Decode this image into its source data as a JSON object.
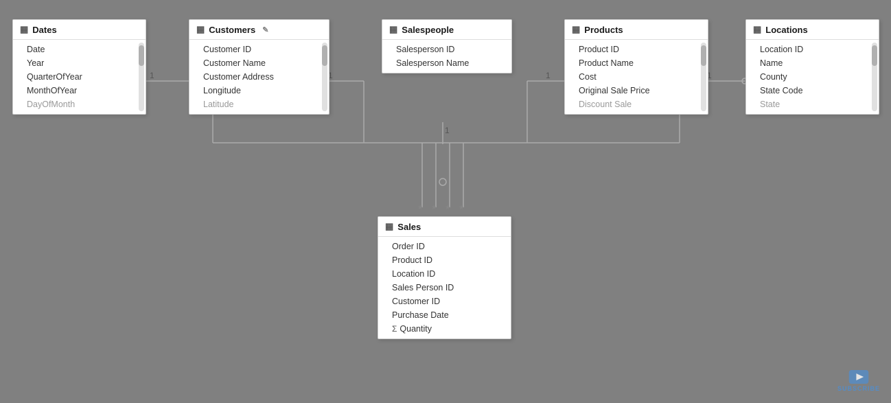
{
  "tables": {
    "dates": {
      "title": "Dates",
      "fields": [
        "Date",
        "Year",
        "QuarterOfYear",
        "MonthOfYear",
        "DayOfMonth"
      ],
      "hasScrollbar": true,
      "faded_from": 4
    },
    "customers": {
      "title": "Customers",
      "fields": [
        "Customer ID",
        "Customer Name",
        "Customer Address",
        "Longitude",
        "Latitude"
      ],
      "hasScrollbar": true,
      "faded_from": 99
    },
    "salespeople": {
      "title": "Salespeople",
      "fields": [
        "Salesperson ID",
        "Salesperson Name"
      ],
      "hasScrollbar": false,
      "faded_from": 99
    },
    "products": {
      "title": "Products",
      "fields": [
        "Product ID",
        "Product Name",
        "Cost",
        "Original Sale Price",
        "Discount Sale"
      ],
      "hasScrollbar": true,
      "faded_from": 4
    },
    "locations": {
      "title": "Locations",
      "fields": [
        "Location ID",
        "Name",
        "County",
        "State Code",
        "State"
      ],
      "hasScrollbar": true,
      "faded_from": 4
    },
    "sales": {
      "title": "Sales",
      "fields": [
        "Order ID",
        "Product ID",
        "Location ID",
        "Sales Person ID",
        "Customer ID",
        "Purchase Date"
      ],
      "sigma_field": "Quantity",
      "hasScrollbar": false,
      "faded_from": 99
    }
  },
  "labels": {
    "one": "1",
    "many": "*",
    "subscribe": "SUBSCRIBE"
  }
}
